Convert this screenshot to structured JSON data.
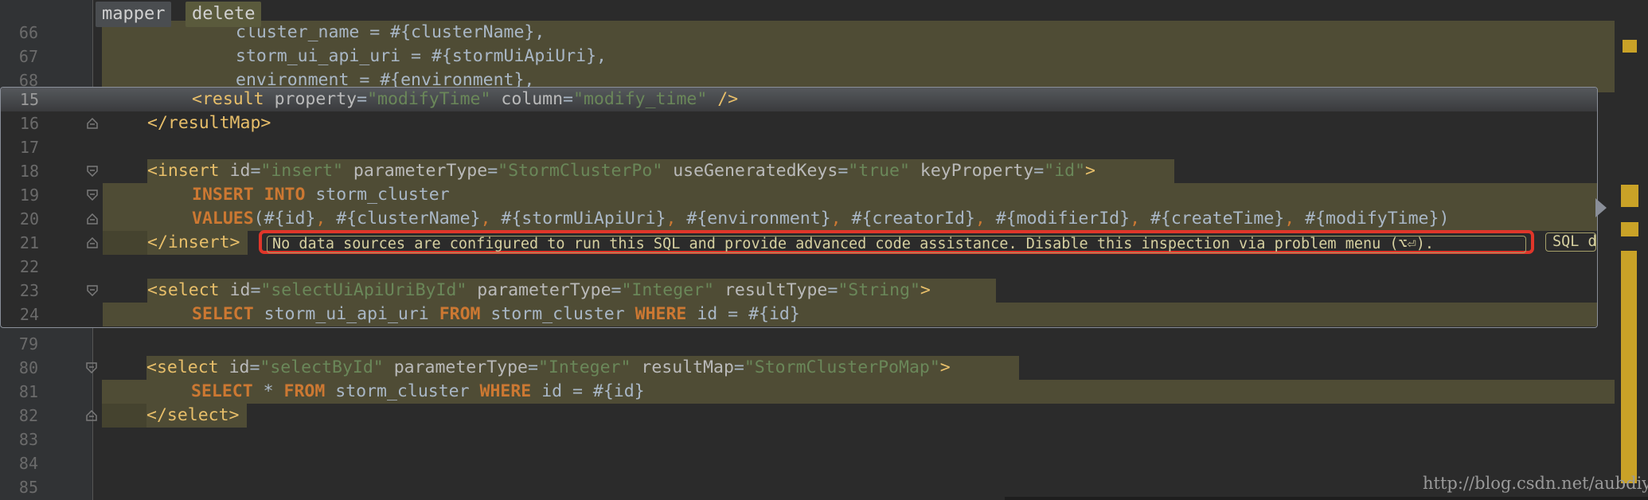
{
  "breadcrumbs": [
    "mapper",
    "delete"
  ],
  "editor": {
    "line_66": "cluster_name = #{clusterName},",
    "line_67": "storm_ui_api_uri = #{stormUiApiUri},",
    "line_68": "environment = #{environment},",
    "nums": {
      "n66": "66",
      "n67": "67",
      "n68": "68",
      "n79": "79",
      "n80": "80",
      "n81": "81",
      "n82": "82",
      "n83": "83",
      "n84": "84",
      "n85": "85"
    },
    "line_80": {
      "tag": "<select",
      "a1": "id",
      "v1": "\"selectById\"",
      "a2": "parameterType",
      "v2": "\"Integer\"",
      "a3": "resultMap",
      "v3": "\"StormClusterPoMap\"",
      "end": ">"
    },
    "line_81": {
      "kw1": "SELECT",
      "star": "*",
      "kw2": "FROM",
      "table": "storm_cluster",
      "kw3": "WHERE",
      "cond": "id = #{id}"
    },
    "line_82": "</select>"
  },
  "popup": {
    "nums": {
      "n15": "15",
      "n16": "16",
      "n17": "17",
      "n18": "18",
      "n19": "19",
      "n20": "20",
      "n21": "21",
      "n22": "22",
      "n23": "23",
      "n24": "24"
    },
    "line_15": {
      "tag": "<result",
      "a1": "property",
      "v1": "\"modifyTime\"",
      "a2": "column",
      "v2": "\"modify_time\"",
      "end": "/>"
    },
    "line_16": "</resultMap>",
    "line_18": {
      "tag": "<insert",
      "a1": "id",
      "v1": "\"insert\"",
      "a2": "parameterType",
      "v2": "\"StormClusterPo\"",
      "a3": "useGeneratedKeys",
      "v3": "\"true\"",
      "a4": "keyProperty",
      "v4": "\"id\"",
      "end": ">"
    },
    "line_19": {
      "kw1": "INSERT",
      "kw2": "INTO",
      "table": "storm_cluster"
    },
    "line_20": {
      "kw": "VALUES",
      "open": "(",
      "p1": "#{id}",
      "p2": "#{clusterName}",
      "p3": "#{stormUiApiUri}",
      "p4": "#{environment}",
      "p5": "#{creatorId}",
      "p6": "#{modifierId}",
      "p7": "#{createTime}",
      "p8": "#{modifyTime}",
      "close": ")",
      "comma": ","
    },
    "line_21": "</insert>",
    "line_23": {
      "tag": "<select",
      "a1": "id",
      "v1": "\"selectUiApiUriById\"",
      "a2": "parameterType",
      "v2": "\"Integer\"",
      "a3": "resultType",
      "v3": "\"String\"",
      "end": ">"
    },
    "line_24": {
      "kw1": "SELECT",
      "cols": "storm_ui_api_uri",
      "kw2": "FROM",
      "table": "storm_cluster",
      "kw3": "WHERE",
      "cond": "id = #{id}"
    },
    "eq": "="
  },
  "inspection": {
    "message": "No data sources are configured to run this SQL and provide advanced code assistance. Disable this inspection via problem menu (⌥⏎).",
    "sql_chip": "SQL d"
  },
  "watermark": "http://blog.csdn.net/aubdiy",
  "colors": {
    "highlight": "#4f4c35",
    "tag": "#e8bf6a",
    "string": "#6a8759",
    "keyword": "#cc7832",
    "error_outline": "#e0362a"
  }
}
